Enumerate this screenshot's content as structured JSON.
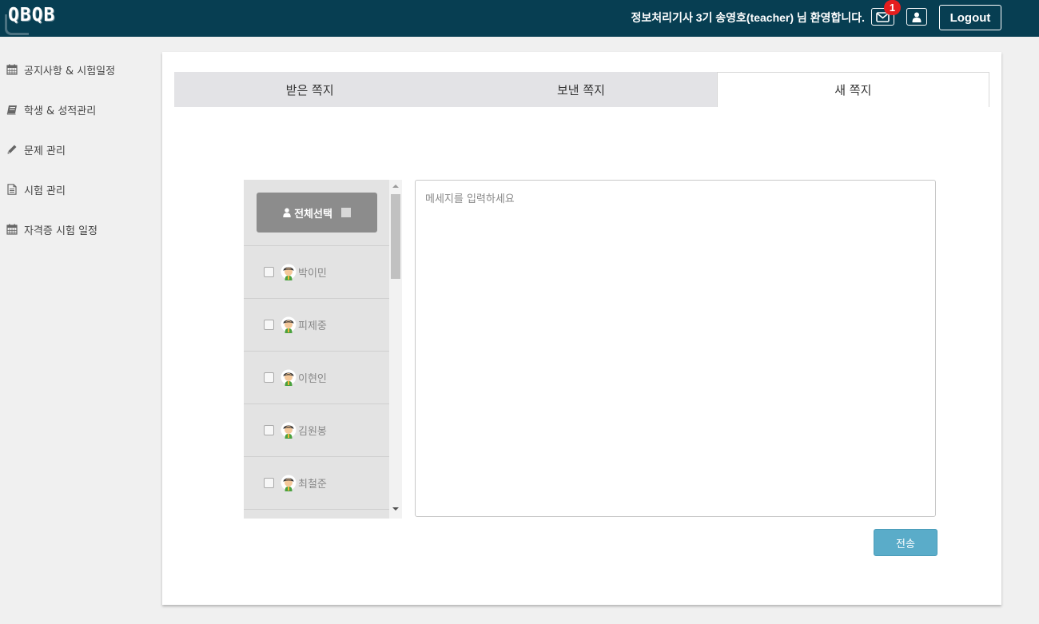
{
  "header": {
    "logo_text": "QBQB",
    "welcome_text": "정보처리기사 3기 송영호(teacher) 님 환영합니다.",
    "mail_badge_count": "1",
    "logout_label": "Logout"
  },
  "sidebar": {
    "items": [
      {
        "label": "공지사항 & 시험일정",
        "icon": "calendar-icon"
      },
      {
        "label": "학생 & 성적관리",
        "icon": "book-icon"
      },
      {
        "label": "문제 관리",
        "icon": "pencil-icon"
      },
      {
        "label": "시험 관리",
        "icon": "document-icon"
      },
      {
        "label": "자격증 시험 일정",
        "icon": "calendar-icon"
      }
    ]
  },
  "tabs": [
    {
      "label": "받은 쪽지"
    },
    {
      "label": "보낸 쪽지"
    },
    {
      "label": "새 쪽지"
    }
  ],
  "recipients": {
    "select_all_label": "전체선택",
    "students": [
      {
        "name": "박이민"
      },
      {
        "name": "피제중"
      },
      {
        "name": "이현인"
      },
      {
        "name": "김원봉"
      },
      {
        "name": "최철준"
      }
    ]
  },
  "compose": {
    "message_value": "",
    "message_placeholder": "메세지를 입력하세요",
    "send_label": "전송"
  },
  "colors": {
    "navbar": "#073e52",
    "badge": "#e41e1e",
    "send_button": "#5aacc9",
    "select_all_button": "#8c8c8c"
  }
}
